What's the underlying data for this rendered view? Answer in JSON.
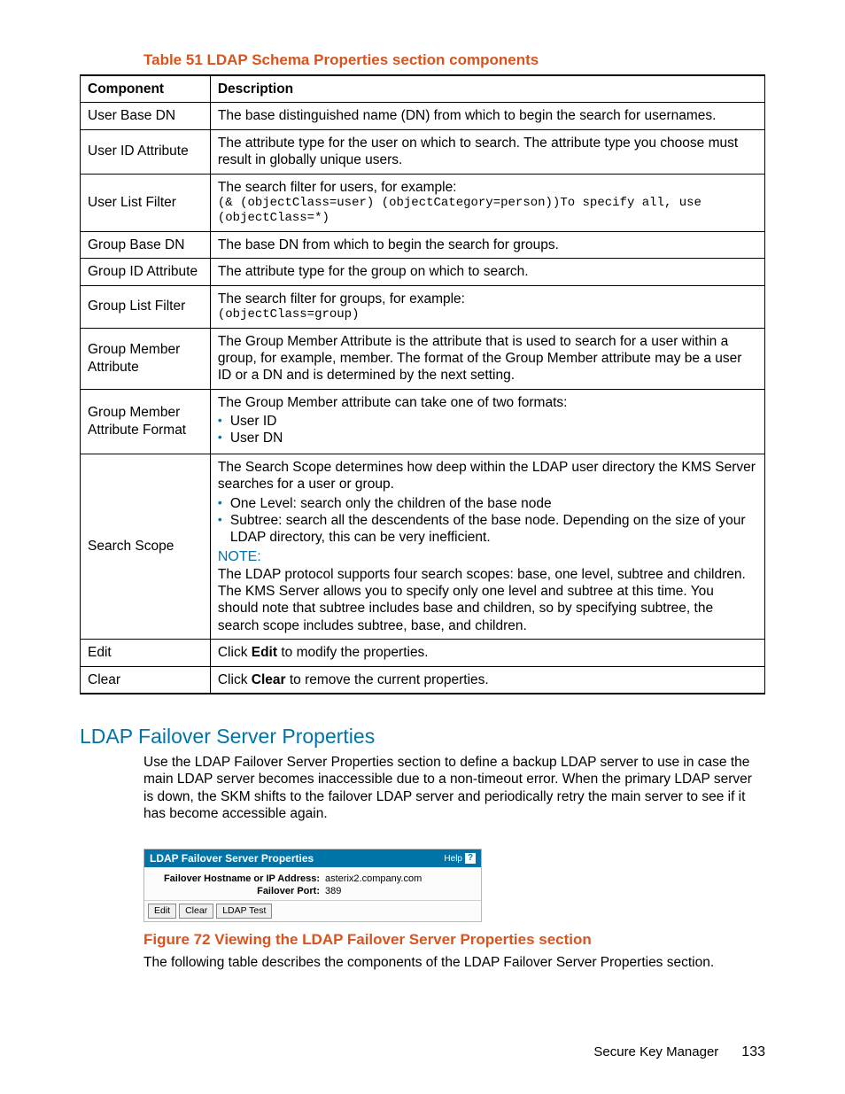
{
  "table_caption": "Table 51 LDAP Schema Properties section components",
  "table": {
    "headers": {
      "c1": "Component",
      "c2": "Description"
    },
    "rows": [
      {
        "comp": "User Base DN",
        "desc_plain": "The base distinguished name (DN) from which to begin the search for usernames."
      },
      {
        "comp": "User ID Attribute",
        "desc_plain": "The attribute type for the user on which to search. The attribute type you choose must result in globally unique users."
      },
      {
        "comp": "User List Filter",
        "desc_intro": "The search filter for users, for example:",
        "code1": "(& (objectClass=user) (objectCategory=person))",
        "code1_tail": "To specify all, use",
        "code2": "(objectClass=*)"
      },
      {
        "comp": "Group Base DN",
        "desc_plain": "The base DN from which to begin the search for groups."
      },
      {
        "comp": "Group ID Attribute",
        "desc_plain": "The attribute type for the group on which to search."
      },
      {
        "comp": "Group List Filter",
        "desc_intro": "The search filter for groups, for example:",
        "code1": "(objectClass=group)"
      },
      {
        "comp": "Group Member Attribute",
        "desc_plain": "The Group Member Attribute is the attribute that is used to search for a user within a group, for example, member. The format of the Group Member attribute may be a user ID or a DN and is determined by the next setting."
      },
      {
        "comp": "Group Member Attribute Format",
        "desc_intro": "The Group Member attribute can take one of two formats:",
        "bullets": [
          "User ID",
          "User DN"
        ]
      },
      {
        "comp": "Search Scope",
        "desc_intro": "The Search Scope determines how deep within the LDAP user directory the KMS Server searches for a user or group.",
        "bullets": [
          "One Level: search only the children of the base node",
          "Subtree: search all the descendents of the base node. Depending on the size of your LDAP directory, this can be very inefficient."
        ],
        "note_label": "NOTE:",
        "note_body": "The LDAP protocol supports four search scopes: base, one level, subtree and children. The KMS Server allows you to specify only one level and subtree at this time. You should note that subtree includes base and children, so by specifying subtree, the search scope includes subtree, base, and children."
      },
      {
        "comp": "Edit",
        "desc_pre": "Click ",
        "desc_bold": "Edit",
        "desc_post": " to modify the properties."
      },
      {
        "comp": "Clear",
        "desc_pre": "Click ",
        "desc_bold": "Clear",
        "desc_post": " to remove the current properties."
      }
    ]
  },
  "section_heading": "LDAP Failover Server Properties",
  "section_body": "Use the LDAP Failover Server Properties section to define a backup LDAP server to use in case the main LDAP server becomes inaccessible due to a non-timeout error. When the primary LDAP server is down, the SKM shifts to the failover LDAP server and periodically retry the main server to see if it has become accessible again.",
  "ui_panel": {
    "title": "LDAP Failover Server Properties",
    "help": "Help",
    "hostname_label": "Failover Hostname or IP Address:",
    "hostname_value": "asterix2.company.com",
    "port_label": "Failover Port:",
    "port_value": "389",
    "buttons": {
      "edit": "Edit",
      "clear": "Clear",
      "test": "LDAP Test"
    }
  },
  "figure_caption": "Figure 72 Viewing the LDAP Failover Server Properties section",
  "post_figure": "The following table describes the components of the LDAP Failover Server Properties section.",
  "footer": {
    "doc": "Secure Key Manager",
    "page": "133"
  }
}
